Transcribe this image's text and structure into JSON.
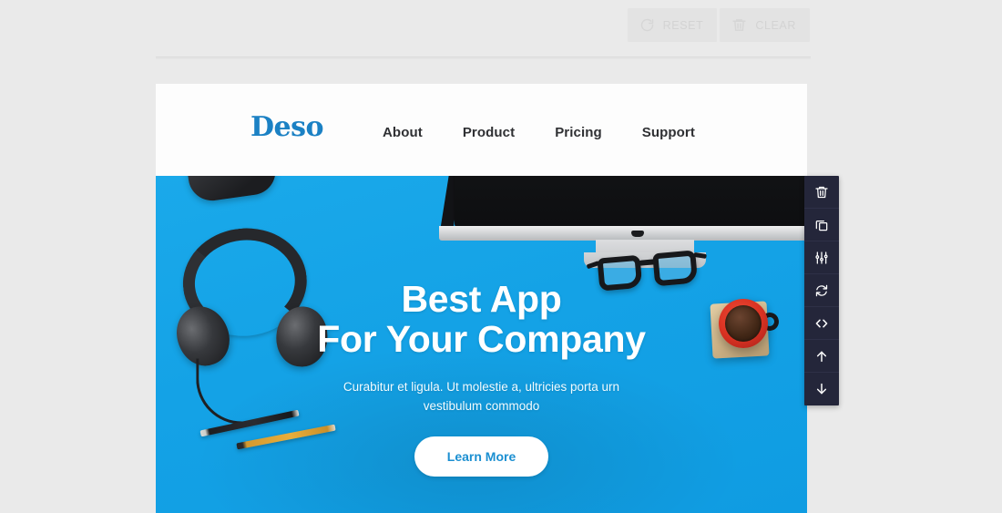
{
  "editor": {
    "toolbar": {
      "buttons": [
        {
          "id": "reset",
          "label": "RESET",
          "icon": "refresh-icon"
        },
        {
          "id": "clear",
          "label": "CLEAR",
          "icon": "trash-icon"
        }
      ]
    },
    "block_toolbar": {
      "items": [
        {
          "id": "delete",
          "icon": "trash-icon",
          "tooltip": "Delete"
        },
        {
          "id": "duplicate",
          "icon": "copy-icon",
          "tooltip": "Duplicate"
        },
        {
          "id": "settings",
          "icon": "sliders-icon",
          "tooltip": "Settings"
        },
        {
          "id": "swap",
          "icon": "refresh-icon",
          "tooltip": "Swap"
        },
        {
          "id": "code",
          "icon": "code-icon",
          "tooltip": "Edit code"
        },
        {
          "id": "move-up",
          "icon": "arrow-up-icon",
          "tooltip": "Move up"
        },
        {
          "id": "move-down",
          "icon": "arrow-down-icon",
          "tooltip": "Move down"
        }
      ]
    }
  },
  "page": {
    "nav": {
      "logo": "Deso",
      "menu": [
        {
          "label": "About"
        },
        {
          "label": "Product"
        },
        {
          "label": "Pricing"
        },
        {
          "label": "Support"
        }
      ]
    },
    "hero": {
      "title_line1": "Best App",
      "title_line2": "For Your Company",
      "subtitle_line1": "Curabitur et ligula. Ut molestie a, ultricies porta urn",
      "subtitle_line2": "vestibulum commodo",
      "cta_label": "Learn More",
      "background_image": "desk-workspace-photo"
    }
  },
  "colors": {
    "app_background": "#eaeaea",
    "canvas_background": "#ffffff",
    "brand_blue": "#1b81c4",
    "hero_blue": "#17a6e8",
    "toolbar_dark": "#24263a",
    "button_idle_bg": "#e3e3e3",
    "button_idle_text": "#d3d3d3"
  }
}
